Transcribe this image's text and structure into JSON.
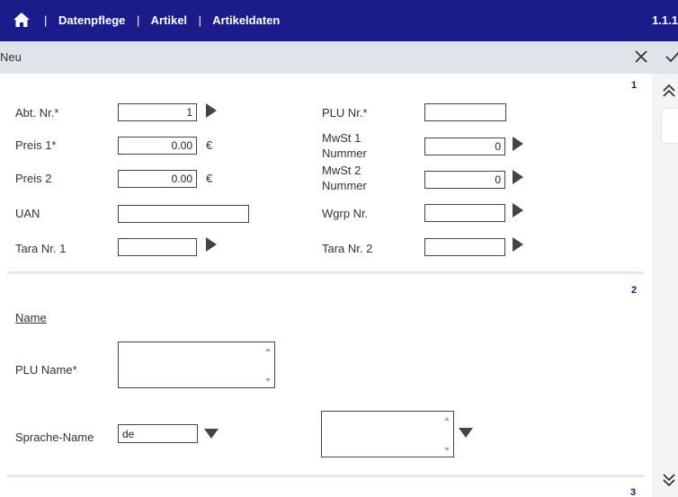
{
  "header": {
    "breadcrumb": [
      "Datenpflege",
      "Artikel",
      "Artikeldaten"
    ],
    "separator": "|",
    "version": "1.1.1"
  },
  "subbar": {
    "mode": "Neu"
  },
  "sections": {
    "s1": "1",
    "s2": "2",
    "s3": "3"
  },
  "form": {
    "abt_nr": {
      "label": "Abt. Nr.*",
      "value": "1"
    },
    "plu_nr": {
      "label": "PLU Nr.*",
      "value": ""
    },
    "preis1": {
      "label": "Preis 1*",
      "value": "0.00",
      "unit": "€"
    },
    "mwst1": {
      "label_line1": "MwSt 1",
      "label_line2": "Nummer",
      "value": "0"
    },
    "preis2": {
      "label": "Preis 2",
      "value": "0.00",
      "unit": "€"
    },
    "mwst2": {
      "label_line1": "MwSt 2",
      "label_line2": "Nummer",
      "value": "0"
    },
    "uan": {
      "label": "UAN",
      "value": ""
    },
    "wgrp_nr": {
      "label": "Wgrp Nr.",
      "value": ""
    },
    "tara1": {
      "label": "Tara Nr. 1",
      "value": ""
    },
    "tara2": {
      "label": "Tara Nr. 2",
      "value": ""
    },
    "name_heading": "Name",
    "plu_name": {
      "label": "PLU Name*",
      "value": ""
    },
    "sprache": {
      "label": "Sprache-Name",
      "value": "de",
      "text": ""
    }
  },
  "colors": {
    "header_bg": "#1b1b8c",
    "subbar_bg": "#dfe3ea",
    "divider": "#e4e8ee"
  }
}
